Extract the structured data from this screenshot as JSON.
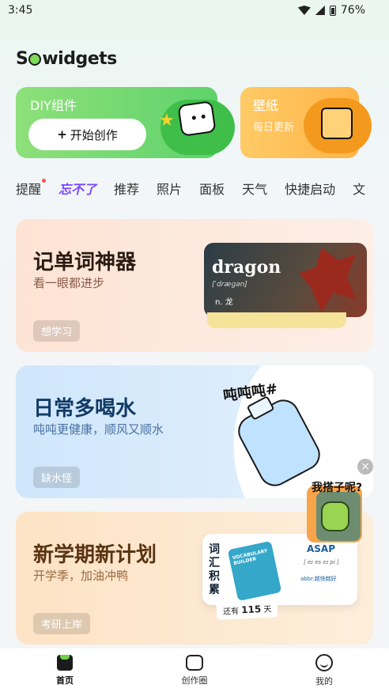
{
  "status_bar": {
    "time": "3:45",
    "battery": "76%"
  },
  "logo": {
    "text_part1": "S",
    "text_part2": "widgets"
  },
  "top_cards": {
    "diy": {
      "title": "DIY组件",
      "button_label": "开始创作"
    },
    "wallpaper": {
      "title": "壁纸",
      "subtitle": "每日更新"
    }
  },
  "tabs": [
    "提醒",
    "忘不了",
    "推荐",
    "照片",
    "面板",
    "天气",
    "快捷启动",
    "文"
  ],
  "cards": [
    {
      "title": "记单词神器",
      "subtitle": "看一眼都进步",
      "badge": "想学习",
      "art": {
        "word": "dragon",
        "phonetic": "[ˈdræɡən]",
        "meaning": "n. 龙"
      }
    },
    {
      "title": "日常多喝水",
      "subtitle": "吨吨更健康，顺风又顺水",
      "badge": "缺水怪",
      "art": {
        "caption": "吨吨吨#"
      }
    },
    {
      "title": "新学期新计划",
      "subtitle": "开学季，加油冲鸭",
      "badge": "考研上岸",
      "art": {
        "side_label": "词汇积累",
        "book_title": "VOCABULARY BUILDER",
        "word": "ASAP",
        "phonetic": "[ eɪ es eɪ pi ]",
        "abbr": "abbr.越快越好",
        "remain_prefix": "还有",
        "remain_num": "115",
        "remain_suffix": "天"
      }
    }
  ],
  "floating_widget": {
    "text": "我搭子呢?",
    "close": "×"
  },
  "bottom_nav": [
    {
      "label": "首页",
      "icon": "home-icon",
      "active": true
    },
    {
      "label": "创作圈",
      "icon": "puzzle-icon",
      "active": false
    },
    {
      "label": "我的",
      "icon": "profile-icon",
      "active": false
    }
  ]
}
